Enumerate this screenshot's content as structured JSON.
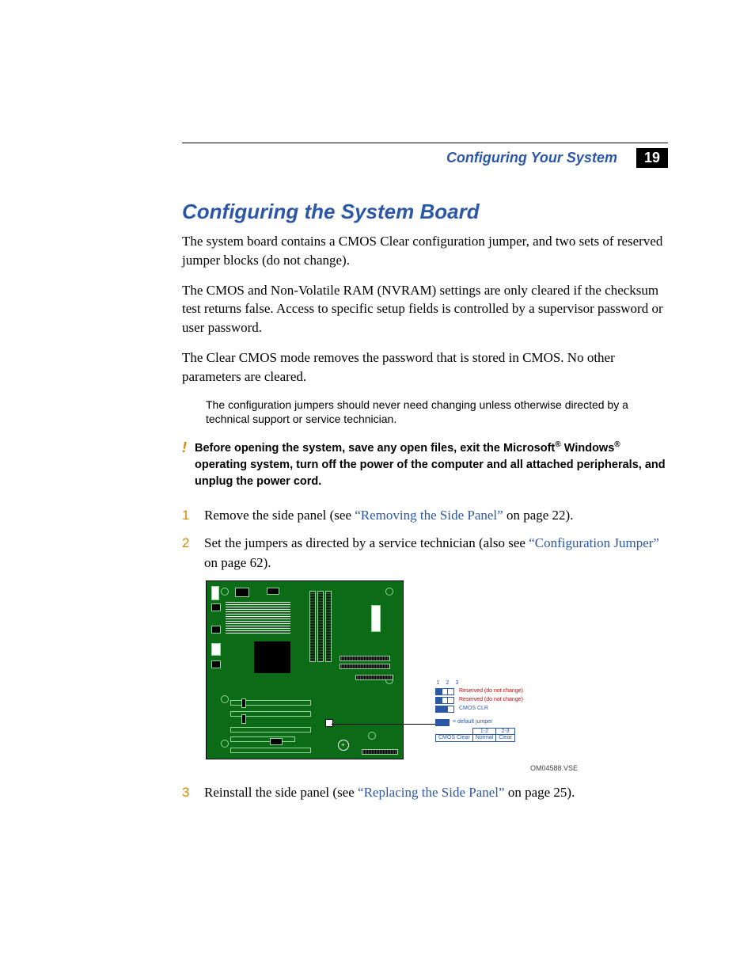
{
  "header": {
    "section_title": "Configuring Your System",
    "page_number": "19"
  },
  "title": "Configuring the System Board",
  "paragraphs": {
    "p1": "The system board contains a CMOS Clear configuration jumper, and two sets of reserved jumper blocks (do not change).",
    "p2": "The CMOS and Non-Volatile RAM (NVRAM) settings are only cleared if the checksum test returns false. Access to specific setup fields is controlled by a supervisor password or user password.",
    "p3": "The Clear CMOS mode removes the password that is stored in CMOS. No other parameters are cleared."
  },
  "note": "The configuration jumpers should never need changing unless otherwise directed by a technical support or service technician.",
  "warning": {
    "bang": "!",
    "pre": "Before opening the system, save any open files, exit the Microsoft",
    "reg1": "®",
    "mid": " Windows",
    "reg2": "®",
    "post": " operating system, turn off the power of the computer and all attached peripherals, and unplug the power cord."
  },
  "steps": {
    "s1": {
      "num": "1",
      "pre": "Remove the side panel (see ",
      "link": "“Removing the Side Panel”",
      "post": " on page 22)."
    },
    "s2": {
      "num": "2",
      "pre": "Set the jumpers as directed by a service technician (also see ",
      "link": "“Configuration Jumper”",
      "post": " on page 62)."
    },
    "s3": {
      "num": "3",
      "pre": "Reinstall the side panel (see ",
      "link": "“Replacing the Side Panel”",
      "post": " on page 25)."
    }
  },
  "legend": {
    "pins": {
      "p1": "1",
      "p2": "2",
      "p3": "3"
    },
    "reserved": "Reserved (do not change)",
    "cmosclr": "CMOS CLR",
    "default_jumper": "= default jumper",
    "table": {
      "h1": "1-2",
      "h2": "2-3",
      "row_label": "CMOS Clear",
      "c1": "Normal",
      "c2": "Clear"
    }
  },
  "figure_code": "OM04588.VSE"
}
